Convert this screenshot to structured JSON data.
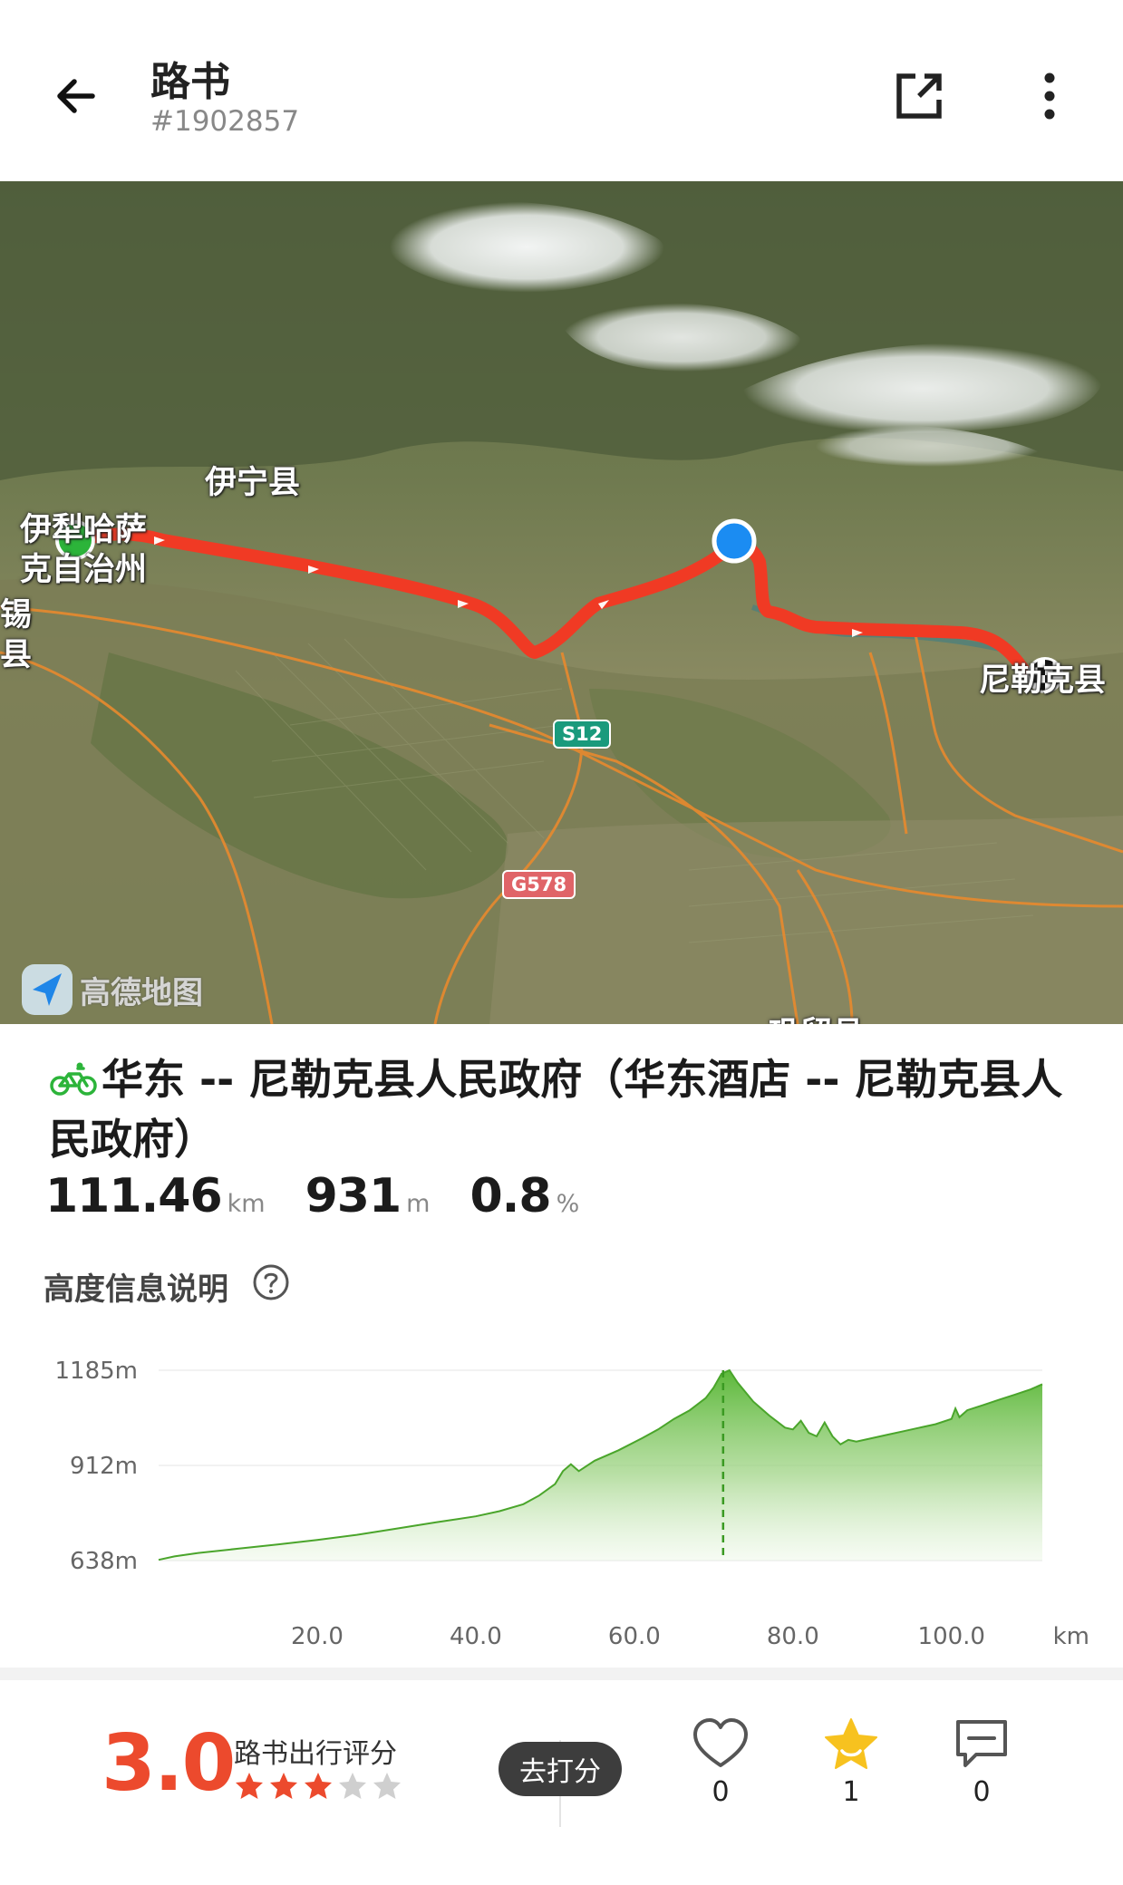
{
  "header": {
    "title": "路书",
    "route_id": "#1902857"
  },
  "map": {
    "labels": {
      "yining_county": "伊宁县",
      "yili_line1": "伊犁哈萨",
      "yili_line2": "克自治州",
      "xi_fragment": "锡",
      "county_fragment": "县",
      "nileke": "尼勒克县",
      "gongliu": "巩留县"
    },
    "road_badges": {
      "s12": "S12",
      "g578": "G578"
    },
    "provider": "高德地图",
    "route_color": "#f03a24"
  },
  "route": {
    "title": "华东 -- 尼勒克县人民政府（华东酒店 -- 尼勒克县人民政府）",
    "distance": "111.46",
    "distance_unit": "km",
    "climb": "931",
    "climb_unit": "m",
    "grade": "0.8",
    "grade_unit": "%"
  },
  "elevation": {
    "label": "高度信息说明"
  },
  "chart_data": {
    "type": "area",
    "xlabel": "km",
    "ylabel": "",
    "y_tick_labels": [
      "1185m",
      "912m",
      "638m"
    ],
    "x_tick_labels": [
      "20.0",
      "40.0",
      "60.0",
      "80.0",
      "100.0"
    ],
    "x_unit_label": "km",
    "xlim": [
      0,
      111.46
    ],
    "ylim": [
      638,
      1185
    ],
    "color": "#5cb83a",
    "marker_x": 71.2,
    "series": [
      {
        "x": [
          0,
          2,
          5,
          10,
          15,
          20,
          25,
          30,
          35,
          40,
          43,
          46,
          48,
          50,
          51,
          52,
          53,
          55,
          58,
          61,
          63,
          65,
          67,
          69,
          70,
          71,
          72,
          73,
          75,
          77,
          79,
          80,
          81,
          82,
          83,
          84,
          85,
          86,
          87,
          88,
          90,
          92,
          94,
          96,
          98,
          100,
          100.5,
          101,
          102,
          104,
          106,
          108,
          110,
          111.46
        ],
        "y": [
          640,
          650,
          660,
          672,
          684,
          697,
          712,
          730,
          748,
          765,
          780,
          800,
          825,
          858,
          895,
          915,
          895,
          925,
          955,
          990,
          1015,
          1045,
          1070,
          1105,
          1135,
          1175,
          1185,
          1150,
          1095,
          1055,
          1020,
          1015,
          1040,
          1005,
          995,
          1035,
          995,
          972,
          985,
          980,
          990,
          1000,
          1010,
          1020,
          1030,
          1045,
          1075,
          1050,
          1070,
          1085,
          1100,
          1115,
          1130,
          1145
        ]
      }
    ]
  },
  "rating": {
    "score": "3.0",
    "label": "路书出行评分",
    "stars": 3,
    "max_stars": 5,
    "rate_button": "去打分"
  },
  "actions": {
    "likes": "0",
    "favorites": "1",
    "comments": "0"
  }
}
